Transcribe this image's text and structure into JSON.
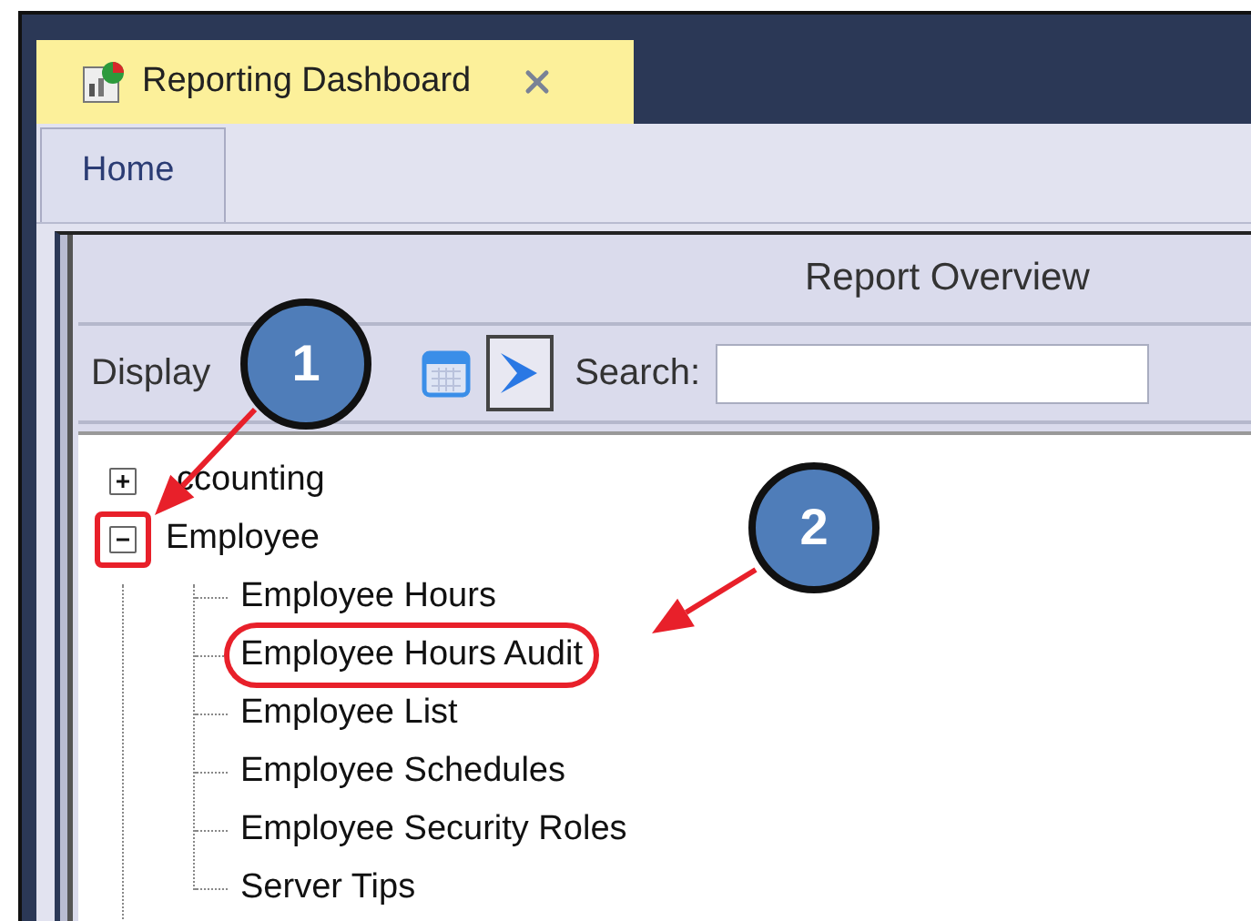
{
  "document_tab": {
    "title": "Reporting Dashboard",
    "selected": true
  },
  "ribbon_tabs": [
    {
      "label": "Home",
      "selected": true
    }
  ],
  "panel": {
    "title": "Report Overview"
  },
  "toolbar": {
    "display_label": "Display",
    "search_label": "Search:"
  },
  "tree": [
    {
      "label": "ccounting",
      "expanded": false,
      "toggle_highlighted": false
    },
    {
      "label": "Employee",
      "expanded": true,
      "toggle_highlighted": true,
      "children": [
        {
          "label": "Employee Hours",
          "highlighted": false
        },
        {
          "label": "Employee Hours Audit",
          "highlighted": true
        },
        {
          "label": "Employee List",
          "highlighted": false
        },
        {
          "label": "Employee Schedules",
          "highlighted": false
        },
        {
          "label": "Employee Security Roles",
          "highlighted": false
        },
        {
          "label": "Server Tips",
          "highlighted": false
        }
      ]
    }
  ],
  "callouts": [
    {
      "number": "1"
    },
    {
      "number": "2"
    }
  ]
}
